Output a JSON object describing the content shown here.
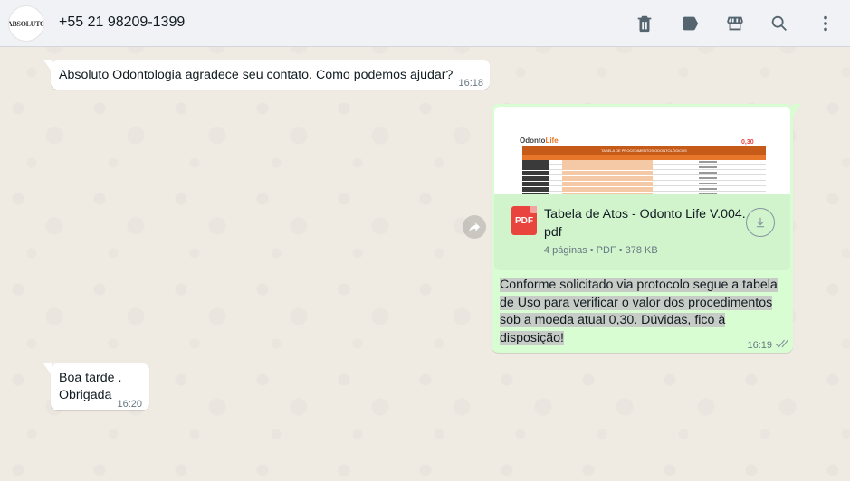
{
  "header": {
    "avatar_text": "ABSOLUTO",
    "contact": "+55 21 98209-1399",
    "icons": [
      "trash-icon",
      "label-icon",
      "store-icon",
      "search-icon",
      "menu-icon"
    ]
  },
  "messages": {
    "m1": {
      "text": "Absoluto Odontologia agradece seu contato. Como podemos ajudar?",
      "time": "16:18"
    },
    "m2": {
      "doc_name": "Tabela de Atos - Odonto Life V.004.pdf",
      "doc_icon_label": "PDF",
      "doc_meta": "4 páginas • PDF • 378 KB",
      "thumb_logo": "Odonto",
      "thumb_logo_accent": "Life",
      "thumb_price": "0,30",
      "thumb_title": "TABELA DE PROCEDIMENTOS ODONTOLÓGICOS",
      "caption": "Conforme solicitado via protocolo segue a tabela de Uso para verificar o valor dos procedimentos sob a moeda atual 0,30. Dúvidas, fico à disposição!",
      "time": "16:19"
    },
    "m3": {
      "line1": "Boa tarde .",
      "line2": "Obrigada",
      "time": "16:20"
    }
  },
  "colors": {
    "incoming": "#ffffff",
    "outgoing": "#d9fdd3",
    "background": "#efeae2",
    "header": "#f0f2f5"
  }
}
